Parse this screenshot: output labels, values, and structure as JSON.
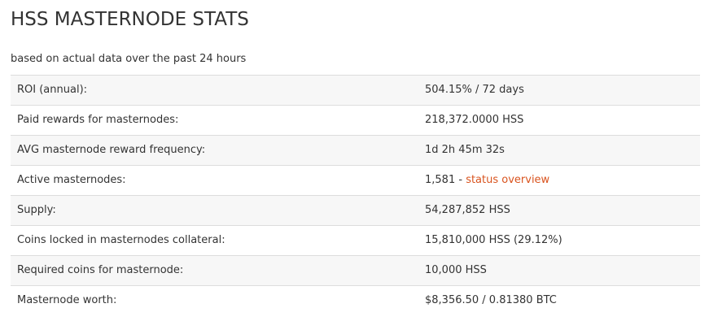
{
  "page": {
    "title": "HSS MASTERNODE STATS",
    "subtitle": "based on actual data over the past 24 hours"
  },
  "stats": {
    "roi": {
      "label": "ROI (annual):",
      "value": "504.15% / 72 days"
    },
    "paid_rewards": {
      "label": "Paid rewards for masternodes:",
      "value": "218,372.0000 HSS"
    },
    "reward_frequency": {
      "label": "AVG masternode reward frequency:",
      "value": "1d 2h 45m 32s"
    },
    "active_masternodes": {
      "label": "Active masternodes:",
      "value": "1,581",
      "separator": " - ",
      "link_text": "status overview"
    },
    "supply": {
      "label": "Supply:",
      "value": "54,287,852 HSS"
    },
    "coins_locked": {
      "label": "Coins locked in masternodes collateral:",
      "value": "15,810,000 HSS (29.12%)"
    },
    "required_coins": {
      "label": "Required coins for masternode:",
      "value": "10,000 HSS"
    },
    "masternode_worth": {
      "label": "Masternode worth:",
      "value": "$8,356.50 / 0.81380 BTC"
    }
  },
  "colors": {
    "link": "#d9531e",
    "row_stripe": "#f7f7f7",
    "border": "#dddddd",
    "text": "#333333"
  }
}
